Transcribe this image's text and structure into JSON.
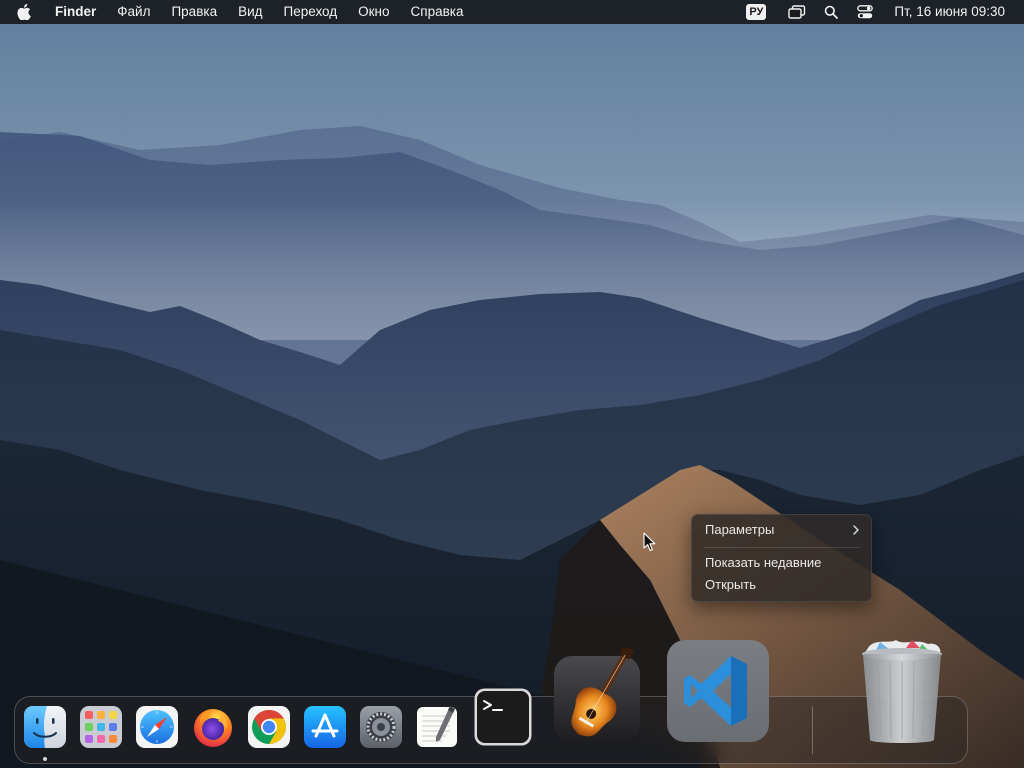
{
  "menubar": {
    "apple_icon": "apple-logo-icon",
    "app_name": "Finder",
    "menus": [
      "Файл",
      "Правка",
      "Вид",
      "Переход",
      "Окно",
      "Справка"
    ],
    "input_source": "РУ",
    "status_icons": [
      "screen-mirroring-icon",
      "spotlight-search-icon",
      "control-center-icon"
    ],
    "clock": "Пт, 16 июня  09:30"
  },
  "context_menu": {
    "items": [
      {
        "label": "Параметры",
        "submenu": true
      },
      {
        "label": "Показать недавние",
        "submenu": false
      },
      {
        "label": "Открыть",
        "submenu": false
      }
    ]
  },
  "dock": {
    "apps": [
      {
        "name": "Finder",
        "icon": "finder-icon",
        "running": true
      },
      {
        "name": "Launchpad",
        "icon": "launchpad-icon"
      },
      {
        "name": "Safari",
        "icon": "safari-icon"
      },
      {
        "name": "Firefox",
        "icon": "firefox-icon"
      },
      {
        "name": "Google Chrome",
        "icon": "chrome-icon"
      },
      {
        "name": "App Store",
        "icon": "app-store-icon"
      },
      {
        "name": "Системные настройки",
        "icon": "system-settings-icon"
      },
      {
        "name": "TextEdit",
        "icon": "textedit-icon"
      },
      {
        "name": "Терминал",
        "icon": "terminal-icon"
      },
      {
        "name": "GarageBand",
        "icon": "garageband-icon"
      },
      {
        "name": "Visual Studio Code",
        "icon": "vscode-icon"
      },
      {
        "name": "Корзина",
        "icon": "trash-full-icon"
      }
    ]
  },
  "colors": {
    "menubar_bg": "#181a1e",
    "sky_top": "#5f7d9c",
    "sky_horizon": "#c3c7cf",
    "vscode_blue": "#2b8fdc",
    "chrome_red": "#db4437",
    "chrome_yellow": "#f4c20d",
    "chrome_green": "#0f9d58",
    "chrome_blue": "#4285f4"
  }
}
